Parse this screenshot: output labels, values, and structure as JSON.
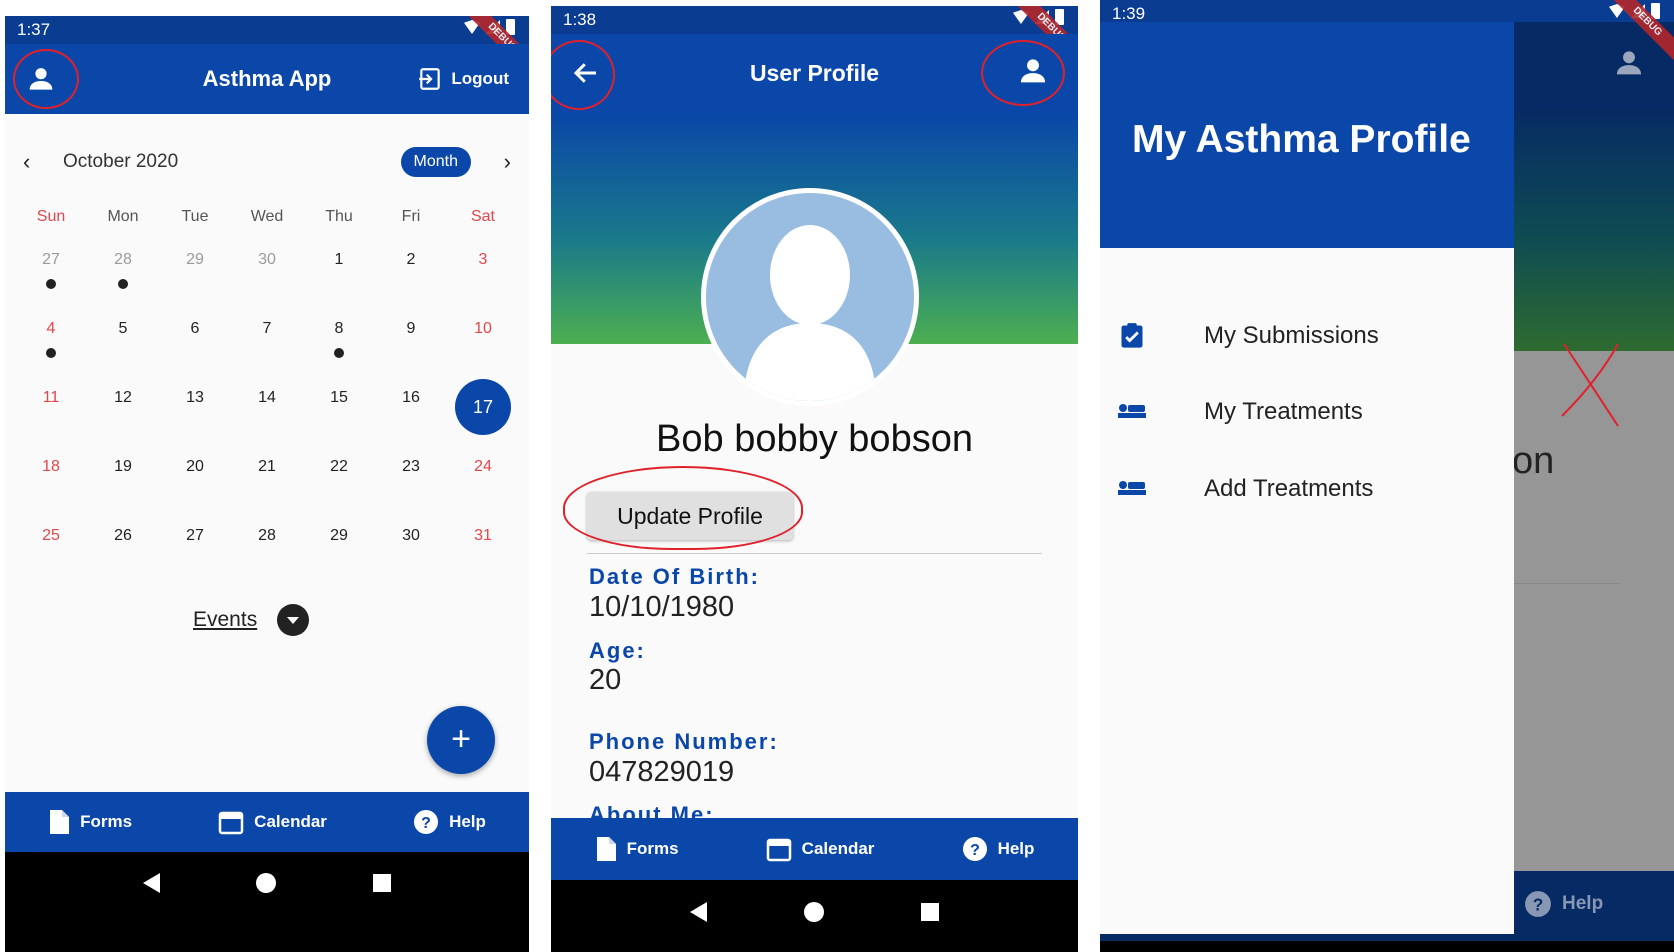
{
  "screen1": {
    "status_time": "1:37",
    "debug_label": "DEBUG",
    "app_title": "Asthma App",
    "logout_label": "Logout",
    "month_label": "October 2020",
    "view_button": "Month",
    "weekdays": [
      "Sun",
      "Mon",
      "Tue",
      "Wed",
      "Thu",
      "Fri",
      "Sat"
    ],
    "weeks": [
      [
        {
          "d": "27",
          "muted": true,
          "event": true
        },
        {
          "d": "28",
          "muted": true,
          "event": true
        },
        {
          "d": "29",
          "muted": true
        },
        {
          "d": "30",
          "muted": true
        },
        {
          "d": "1"
        },
        {
          "d": "2"
        },
        {
          "d": "3"
        }
      ],
      [
        {
          "d": "4",
          "event": true
        },
        {
          "d": "5"
        },
        {
          "d": "6"
        },
        {
          "d": "7"
        },
        {
          "d": "8",
          "event": true
        },
        {
          "d": "9"
        },
        {
          "d": "10"
        }
      ],
      [
        {
          "d": "11"
        },
        {
          "d": "12"
        },
        {
          "d": "13"
        },
        {
          "d": "14"
        },
        {
          "d": "15"
        },
        {
          "d": "16"
        },
        {
          "d": "17",
          "today": true
        }
      ],
      [
        {
          "d": "18"
        },
        {
          "d": "19"
        },
        {
          "d": "20"
        },
        {
          "d": "21"
        },
        {
          "d": "22"
        },
        {
          "d": "23"
        },
        {
          "d": "24"
        }
      ],
      [
        {
          "d": "25"
        },
        {
          "d": "26"
        },
        {
          "d": "27"
        },
        {
          "d": "28"
        },
        {
          "d": "29"
        },
        {
          "d": "30"
        },
        {
          "d": "31"
        }
      ]
    ],
    "events_label": "Events",
    "fab_label": "+",
    "nav": {
      "forms": "Forms",
      "calendar": "Calendar",
      "help": "Help"
    }
  },
  "screen2": {
    "status_time": "1:38",
    "debug_label": "DEBUG",
    "title": "User Profile",
    "name": "Bob bobby bobson",
    "update_button": "Update Profile",
    "dob_label": "Date Of Birth:",
    "dob_value": "10/10/1980",
    "age_label": "Age:",
    "age_value": "20",
    "phone_label": "Phone Number:",
    "phone_value": "047829019",
    "about_label": "About Me:",
    "nav": {
      "forms": "Forms",
      "calendar": "Calendar",
      "help": "Help"
    }
  },
  "screen3": {
    "status_time": "1:39",
    "debug_label": "DEBUG",
    "drawer_title": "My Asthma Profile",
    "items": [
      {
        "label": "My Submissions",
        "icon": "clipboard-check-icon"
      },
      {
        "label": "My Treatments",
        "icon": "bed-icon"
      },
      {
        "label": "Add Treatments",
        "icon": "bed-icon"
      }
    ],
    "bg_text": "on",
    "bg_help": "Help"
  },
  "colors": {
    "primary": "#0a47a8",
    "status": "#0a3d91",
    "weekend": "#e0474c",
    "annotation": "#e0212b"
  }
}
